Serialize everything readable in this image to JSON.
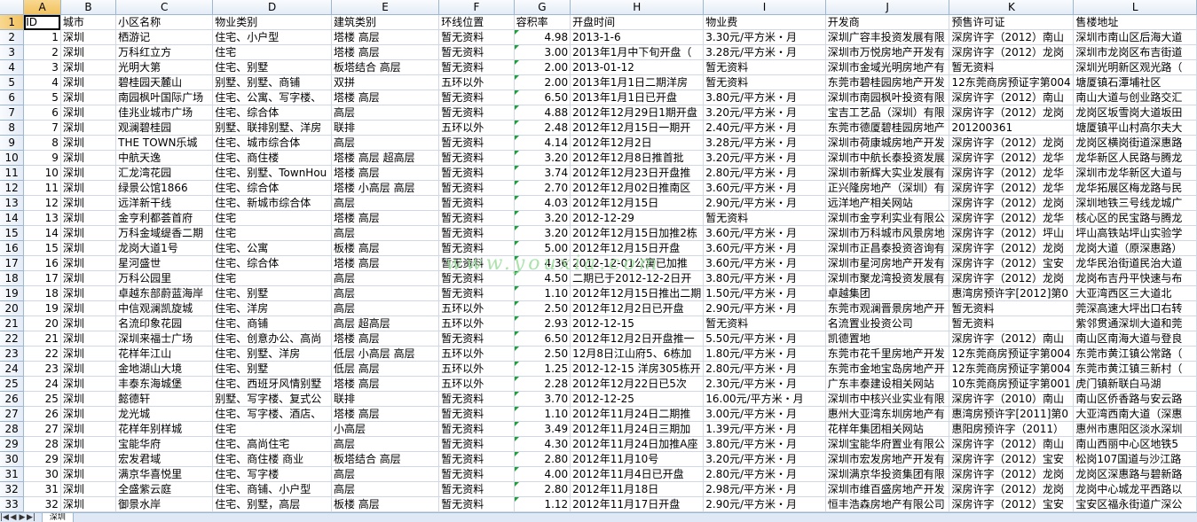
{
  "sheet": {
    "column_letters": [
      "A",
      "B",
      "C",
      "D",
      "E",
      "F",
      "G",
      "H",
      "I",
      "J",
      "K",
      "L"
    ],
    "headers": [
      "ID",
      "城市",
      "小区名称",
      "物业类别",
      "建筑类别",
      "环线位置",
      "容积率",
      "开盘时间",
      "物业费",
      "开发商",
      "预售许可证",
      "售楼地址"
    ],
    "rows": [
      [
        "1",
        "深圳",
        "栖游记",
        "住宅、小户型",
        "塔楼 高层",
        "暂无资料",
        "4.98",
        "2013-1-6",
        "3.30元/平方米・月",
        "深圳广容丰投资发展有限",
        "深房许字（2012）南山",
        "深圳市南山区后海大道"
      ],
      [
        "2",
        "深圳",
        "万科红立方",
        "住宅",
        "塔楼 高层",
        "暂无资料",
        "3.00",
        "2013年1月中下旬开盘（",
        "3.28元/平方米・月",
        "深圳市万悦房地产开发有",
        "深房许字（2012）龙岗",
        "深圳市龙岗区布吉街道"
      ],
      [
        "3",
        "深圳",
        "光明大第",
        "住宅、别墅",
        "板塔结合 高层",
        "暂无资料",
        "2.00",
        "2013-01-12",
        "暂无资料",
        "深圳市金域光明房地产有",
        "暂无资料",
        "深圳光明新区观光路（"
      ],
      [
        "4",
        "深圳",
        "碧桂园天麓山",
        "别墅、别墅、商铺",
        "双拼",
        "五环以外",
        "2.00",
        "2013年1月1日二期洋房",
        "暂无资料",
        "东莞市碧桂园房地产开发",
        "12东莞商房预证字第004",
        "塘厦镇石潭埔社区"
      ],
      [
        "5",
        "深圳",
        "南园枫叶国际广场",
        "住宅、公寓、写字楼、",
        "塔楼 高层",
        "暂无资料",
        "6.50",
        "2013年1月1日已开盘",
        "3.80元/平方米・月",
        "深圳市南园枫叶投资有限",
        "深房许字（2012）南山",
        "南山大道与创业路交汇"
      ],
      [
        "6",
        "深圳",
        "佳兆业城市广场",
        "住宅、综合体",
        "高层",
        "暂无资料",
        "4.88",
        "2012年12月29日1期开盘",
        "3.20元/平方米・月",
        "宝吉工艺品（深圳）有限",
        "深房许字（2012）龙岗",
        "龙岗区坂雪岗大道坂田"
      ],
      [
        "7",
        "深圳",
        "观澜碧桂园",
        "别墅、联排别墅、洋房",
        "联排",
        "五环以外",
        "2.48",
        "2012年12月15日一期开",
        "2.40元/平方米・月",
        "东莞市德厦碧桂园房地产",
        "201200361",
        "塘厦镇平山村高尔夫大"
      ],
      [
        "8",
        "深圳",
        "THE TOWN乐城",
        "住宅、城市综合体",
        "高层",
        "暂无资料",
        "4.14",
        "2012年12月2日",
        "3.28元/平方米・月",
        "深圳市荷康城房地产开发",
        "深房许字（2012）龙岗",
        "龙岗区横岗街道深惠路"
      ],
      [
        "9",
        "深圳",
        "中航天逸",
        "住宅、商住楼",
        "塔楼 高层 超高层",
        "暂无资料",
        "3.20",
        "2012年12月8日推首批",
        "3.20元/平方米・月",
        "深圳市中航长泰投资发展",
        "深房许字（2012）龙华",
        "龙华新区人民路与腾龙"
      ],
      [
        "10",
        "深圳",
        "汇龙湾花园",
        "住宅、别墅、TownHou",
        "塔楼 高层",
        "暂无资料",
        "3.74",
        "2012年12月23日开盘推",
        "2.80元/平方米・月",
        "深圳市新辉大实业发展有",
        "深房许字（2012）龙华",
        "深圳市龙华新区大道与"
      ],
      [
        "11",
        "深圳",
        "绿景公馆1866",
        "住宅、综合体",
        "塔楼 小高层 高层",
        "暂无资料",
        "2.70",
        "2012年12月02日推南区",
        "3.60元/平方米・月",
        "正兴隆房地产（深圳）有",
        "深房许字（2012）龙华",
        "龙华拓展区梅龙路与民"
      ],
      [
        "12",
        "深圳",
        "远洋新干线",
        "住宅、新城市综合体",
        "高层",
        "暂无资料",
        "4.03",
        "2012年12月15日",
        "2.90元/平方米・月",
        "远洋地产相关网站",
        "深房许字（2012）龙岗",
        "深圳地铁三号线龙城广"
      ],
      [
        "13",
        "深圳",
        "金亨利都荟首府",
        "住宅",
        "塔楼 高层",
        "暂无资料",
        "3.20",
        "2012-12-29",
        "暂无资料",
        "深圳市金亨利实业有限公",
        "深房许字（2012）龙华",
        "核心区的民宝路与腾龙"
      ],
      [
        "14",
        "深圳",
        "万科金域缇香二期",
        "住宅",
        "高层",
        "暂无资料",
        "3.20",
        "2012年12月15日加推2栋",
        "3.60元/平方米・月",
        "深圳市万科城市风景房地",
        "深房许字（2012）坪山",
        "坪山高铁站坪山实验学"
      ],
      [
        "15",
        "深圳",
        "龙岗大道1号",
        "住宅、公寓",
        "板楼 高层",
        "暂无资料",
        "5.00",
        "2012年12月15日开盘",
        "3.60元/平方米・月",
        "深圳市正昌泰投资咨询有",
        "深房许字（2012）龙岗",
        "龙岗大道（原深惠路）"
      ],
      [
        "16",
        "深圳",
        "星河盛世",
        "住宅、综合体",
        "塔楼 高层",
        "暂无资料",
        "4.36",
        "2012-12-01公寓已加推",
        "3.60元/平方米・月",
        "深圳市星河房地产开发有",
        "深房许字（2012）宝安",
        "龙华民治街道民治大道"
      ],
      [
        "17",
        "深圳",
        "万科公园里",
        "住宅",
        "高层",
        "暂无资料",
        "4.50",
        "二期已于2012-12-2日开",
        "3.80元/平方米・月",
        "深圳市聚龙湾投资发展有",
        "深房许字（2012）龙岗",
        "龙岗布吉丹平快速与布"
      ],
      [
        "18",
        "深圳",
        "卓越东部蔚蓝海岸",
        "住宅、别墅",
        "高层",
        "暂无资料",
        "1.10",
        "2012年12月15日推出二期",
        "1.50元/平方米・月",
        "卓越集团",
        "惠湾房预许字[2012]第0",
        "大亚湾西区三大道北"
      ],
      [
        "19",
        "深圳",
        "中信观澜凯旋城",
        "住宅、洋房",
        "高层",
        "五环以外",
        "2.50",
        "2012年12月2日已开盘",
        "2.90元/平方米・月",
        "东莞市观澜晋景房地产开",
        "暂无资料",
        "莞深高速大坪出口右转"
      ],
      [
        "20",
        "深圳",
        "名流印象花园",
        "住宅、商铺",
        "高层 超高层",
        "五环以外",
        "2.93",
        "2012-12-15",
        "暂无资料",
        "名流置业投资公司",
        "暂无资料",
        "紫邻贯通深圳大道和莞"
      ],
      [
        "21",
        "深圳",
        "深圳来福士广场",
        "住宅、创意办公、高尚",
        "塔楼 高层",
        "暂无资料",
        "6.50",
        "2012年12月2日开盘推一",
        "5.50元/平方米・月",
        "凯德置地",
        "深房许字（2012）南山",
        "南山区南海大道与登良"
      ],
      [
        "22",
        "深圳",
        "花样年江山",
        "住宅、别墅、洋房",
        "低层 小高层 高层",
        "五环以外",
        "2.50",
        "12月8日江山府5、6栋加",
        "1.80元/平方米・月",
        "东莞市花千里房地产开发",
        "12东莞商房预证字第004",
        "东莞市黄江镇公常路（"
      ],
      [
        "23",
        "深圳",
        "金地湖山大境",
        "住宅、别墅",
        "低层 高层",
        "五环以外",
        "1.25",
        "2012-12-15 洋房305栋开",
        "2.80元/平方米・月",
        "东莞市金地宝岛房地产开",
        "12东莞商房预证字第004",
        "东莞市黄江镇三新村（"
      ],
      [
        "24",
        "深圳",
        "丰泰东海城堡",
        "住宅、西班牙风情别墅",
        "塔楼 高层",
        "五环以外",
        "2.28",
        "2012年12月22日已5次",
        "2.30元/平方米・月",
        "广东丰泰建设相关网站",
        "10东莞商房预证字第001",
        "虎门镇新联白马湖"
      ],
      [
        "25",
        "深圳",
        "懿德轩",
        "别墅、写字楼、复式公",
        "联排",
        "暂无资料",
        "3.70",
        "2012-12-25",
        "16.00元/平方米・月",
        "深圳市中核兴业实业有限",
        "深房许字（2010）南山",
        "南山区侨香路与安云路"
      ],
      [
        "26",
        "深圳",
        "龙光城",
        "住宅、写字楼、酒店、",
        "塔楼 高层",
        "暂无资料",
        "1.10",
        "2012年11月24日二期推",
        "3.00元/平方米・月",
        "惠州大亚湾东圳房地产有",
        "惠湾房预许字[2011]第0",
        "大亚湾西南大道（深惠"
      ],
      [
        "27",
        "深圳",
        "花样年别样城",
        "住宅",
        "小高层",
        "暂无资料",
        "3.49",
        "2012年11月24日三期加",
        "1.39元/平方米・月",
        "花样年集团相关网站",
        "惠阳房预许字（2011）",
        "惠州市惠阳区淡水深圳"
      ],
      [
        "28",
        "深圳",
        "宝能华府",
        "住宅、高尚住宅",
        "高层",
        "暂无资料",
        "4.30",
        "2012年11月24日加推A座",
        "3.80元/平方米・月",
        "深圳宝能华府置业有限公",
        "深房许字（2012）南山",
        "南山西丽中心区地铁5"
      ],
      [
        "29",
        "深圳",
        "宏发君域",
        "住宅、商住楼 商业",
        "板塔结合 高层",
        "暂无资料",
        "2.80",
        "2012年11月10号",
        "3.20元/平方米・月",
        "深圳市宏发房地产开发有",
        "深房许字（2012）宝安",
        "松岗107国道与沙江路"
      ],
      [
        "30",
        "深圳",
        "满京华喜悦里",
        "住宅、写字楼",
        "高层",
        "暂无资料",
        "4.00",
        "2012年11月4日已开盘",
        "2.80元/平方米・月",
        "深圳满京华投资集团有限",
        "深房许字（2012）龙岗",
        "龙岗区深惠路与碧新路"
      ],
      [
        "31",
        "深圳",
        "全盛紫云庭",
        "住宅、商铺、小户型",
        "高层",
        "暂无资料",
        "2.80",
        "2012年11月18日",
        "2.98元/平方米・月",
        "深圳市维百盛房地产开发",
        "深房许字（2012）龙岗",
        "龙岗中心城龙平西路以"
      ],
      [
        "32",
        "深圳",
        "御景水岸",
        "住宅、别墅，高层",
        "板楼 高层",
        "暂无资料",
        "1.12",
        "2012年11月17日开盘",
        "2.90元/平方米・月",
        "恒丰浩森房地产有限公司",
        "深房许字（2012）宝安",
        "宝安区福永街道广深公"
      ]
    ]
  },
  "selected_cell": "A1",
  "watermark": "www.youxia.com",
  "tabbar": {
    "nav_buttons": [
      "|◀",
      "◀",
      "▶",
      "▶|"
    ],
    "sheet_tab": "深圳"
  },
  "colors": {
    "grid_line": "#d0d7e5",
    "header_bg": "#e4ecf7",
    "active_header": "#f1c15f",
    "number_triangle": "#1e9e3c"
  }
}
